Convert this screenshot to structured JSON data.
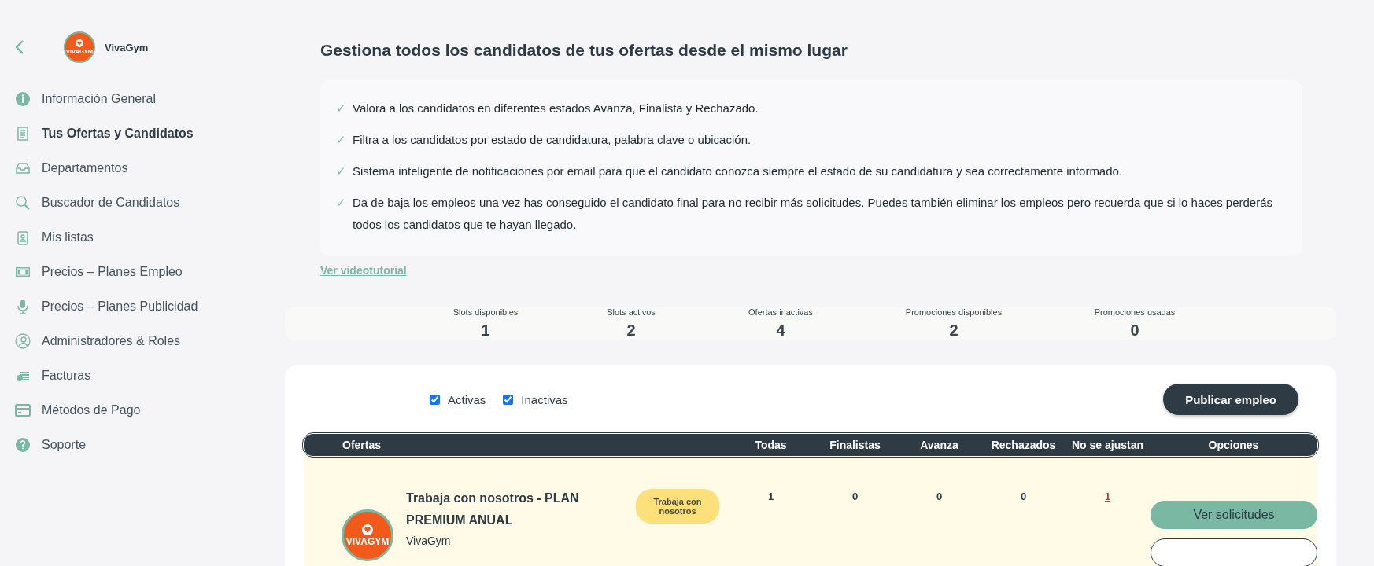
{
  "sidebar": {
    "company": {
      "logo_text": "VIVAGYM",
      "name": "VivaGym"
    },
    "items": [
      {
        "label": "Información General",
        "selected": false
      },
      {
        "label": "Tus Ofertas y Candidatos",
        "selected": true
      },
      {
        "label": "Departamentos",
        "selected": false
      },
      {
        "label": "Buscador de Candidatos",
        "selected": false
      },
      {
        "label": "Mis listas",
        "selected": false
      },
      {
        "label": "Precios – Planes Empleo",
        "selected": false
      },
      {
        "label": "Precios – Planes Publicidad",
        "selected": false
      },
      {
        "label": "Administradores & Roles",
        "selected": false
      },
      {
        "label": "Facturas",
        "selected": false
      },
      {
        "label": "Métodos de Pago",
        "selected": false
      },
      {
        "label": "Soporte",
        "selected": false
      }
    ]
  },
  "heading": "Gestiona todos los candidatos de tus ofertas desde el mismo lugar",
  "features": [
    {
      "mark": "✓",
      "text": "Valora a los candidatos en diferentes estados Avanza, Finalista y Rechazado."
    },
    {
      "mark": "✓",
      "text": "Filtra a los candidatos por estado de candidatura, palabra clave o ubicación."
    },
    {
      "mark": "✓",
      "text": "Sistema inteligente de notificaciones por email para que el candidato conozca siempre el estado de su candidatura y sea correctamente informado."
    },
    {
      "mark": "✓",
      "text": "Da de baja los empleos una vez has conseguido el candidato final para no recibir más solicitudes. Puedes también eliminar los empleos pero recuerda que si lo haces perderás todos los candidatos que te hayan llegado."
    }
  ],
  "video_link": "Ver videotutorial",
  "stats": [
    {
      "label": "Slots disponibles",
      "value": "1"
    },
    {
      "label": "Slots activos",
      "value": "2"
    },
    {
      "label": "Ofertas inactivas",
      "value": "4"
    },
    {
      "label": "Promociones disponibles",
      "value": "2"
    },
    {
      "label": "Promociones usadas",
      "value": "0"
    }
  ],
  "filters": [
    {
      "label": "Activas",
      "checked": true
    },
    {
      "label": "Inactivas",
      "checked": true
    }
  ],
  "publish_button": "Publicar empleo",
  "table": {
    "columns": [
      "Ofertas",
      "Todas",
      "Finalistas",
      "Avanza",
      "Rechazados",
      "No se ajustan",
      "Opciones"
    ],
    "rows": [
      {
        "logo_text": "VIVAGYM",
        "title": "Trabaja con nosotros - PLAN PREMIUM ANUAL",
        "company": "VivaGym",
        "tag": "Trabaja con nosotros",
        "counts": [
          {
            "value": "1",
            "kind": "plain"
          },
          {
            "value": "0",
            "kind": "plain"
          },
          {
            "value": "0",
            "kind": "plain"
          },
          {
            "value": "0",
            "kind": "plain"
          },
          {
            "value": "1",
            "kind": "link"
          }
        ],
        "actions": [
          {
            "label": "Ver solicitudes",
            "kind": "filled"
          },
          {
            "kind": "outline"
          }
        ]
      }
    ]
  }
}
